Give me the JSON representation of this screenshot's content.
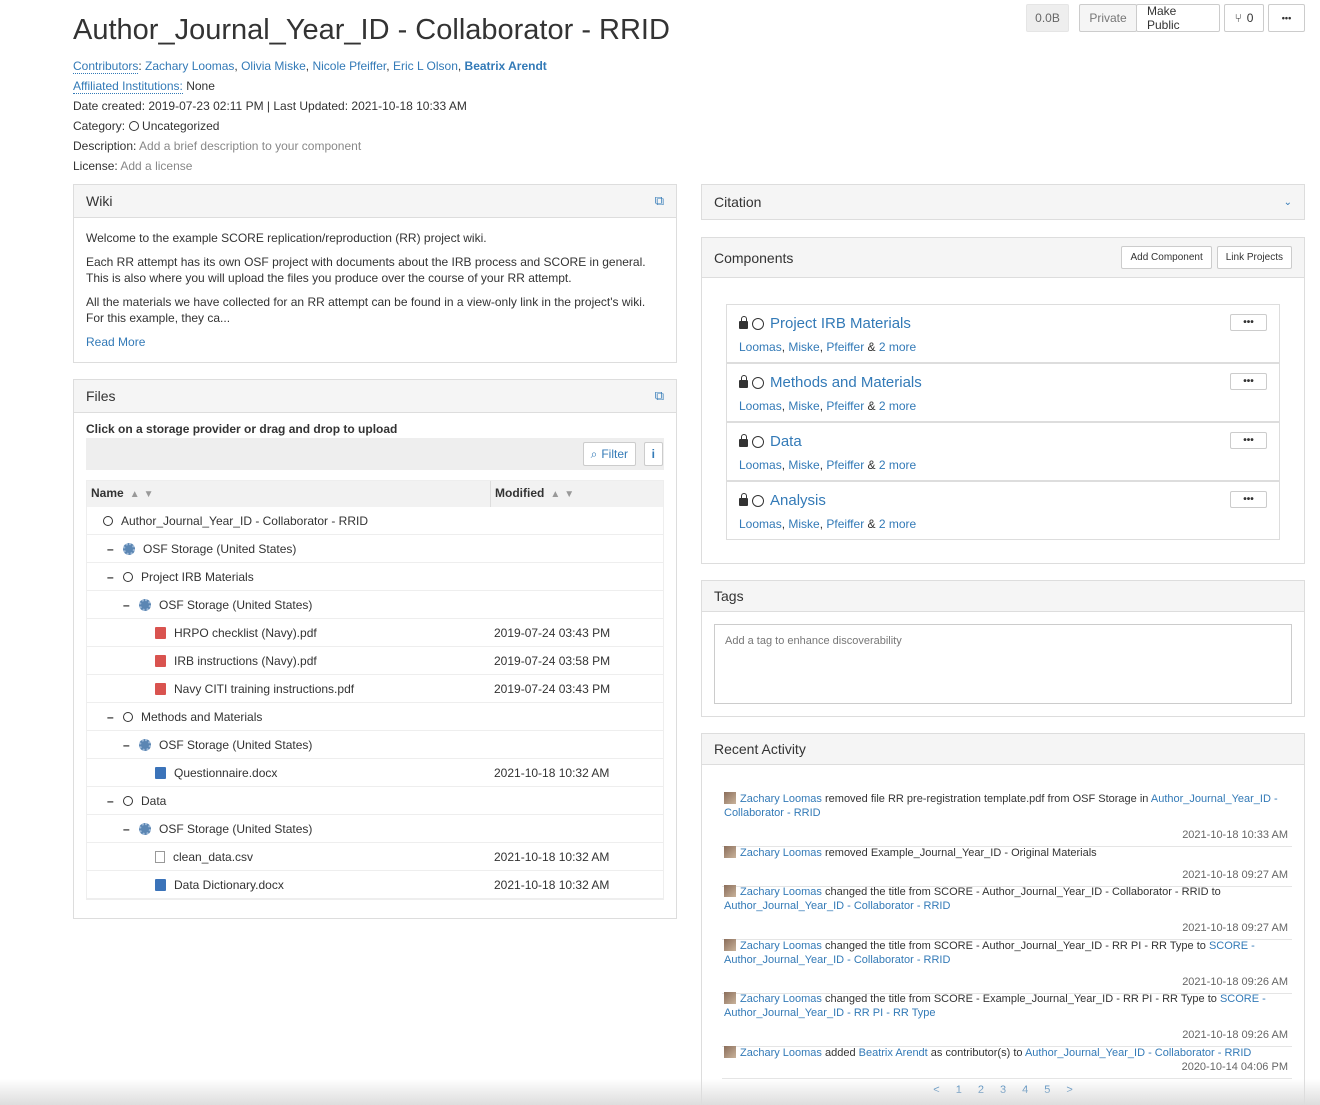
{
  "header": {
    "title": "Author_Journal_Year_ID - Collaborator - RRID",
    "size_badge": "0.0B",
    "private_label": "Private",
    "make_public_label": "Make Public",
    "fork_count": "0",
    "more_label": "•••"
  },
  "meta": {
    "contributors_label": "Contributors",
    "contributors": [
      "Zachary Loomas",
      "Olivia Miske",
      "Nicole Pfeiffer",
      "Eric L Olson",
      "Beatrix Arendt"
    ],
    "affiliated_label": "Affiliated Institutions:",
    "affiliated_value": "None",
    "dates": "Date created: 2019-07-23 02:11 PM | Last Updated: 2021-10-18 10:33 AM",
    "category_label": "Category:",
    "category_value": "Uncategorized",
    "description_label": "Description:",
    "description_value": "Add a brief description to your component",
    "license_label": "License:",
    "license_value": "Add a license"
  },
  "wiki": {
    "title": "Wiki",
    "p1": "Welcome to the example SCORE replication/reproduction (RR) project wiki.",
    "p2": "Each RR attempt has its own OSF project with documents about the IRB process and SCORE in general. This is also where you will upload the files you produce over the course of your RR attempt.",
    "p3": "All the materials we have collected for an RR attempt can be found in a view-only link in the project's wiki. For this example, they ca...",
    "read_more": "Read More"
  },
  "files": {
    "title": "Files",
    "hint": "Click on a storage provider or drag and drop to upload",
    "filter_label": "Filter",
    "info_label": "i",
    "col_name": "Name",
    "col_modified": "Modified",
    "rows": [
      {
        "name": "Author_Journal_Year_ID - Collaborator - RRID",
        "modified": ""
      },
      {
        "name": "OSF Storage (United States)",
        "modified": ""
      },
      {
        "name": "Project IRB Materials",
        "modified": ""
      },
      {
        "name": "OSF Storage (United States)",
        "modified": ""
      },
      {
        "name": "HRPO checklist (Navy).pdf",
        "modified": "2019-07-24 03:43 PM"
      },
      {
        "name": "IRB instructions (Navy).pdf",
        "modified": "2019-07-24 03:58 PM"
      },
      {
        "name": "Navy CITI training instructions.pdf",
        "modified": "2019-07-24 03:43 PM"
      },
      {
        "name": "Methods and Materials",
        "modified": ""
      },
      {
        "name": "OSF Storage (United States)",
        "modified": ""
      },
      {
        "name": "Questionnaire.docx",
        "modified": "2021-10-18 10:32 AM"
      },
      {
        "name": "Data",
        "modified": ""
      },
      {
        "name": "OSF Storage (United States)",
        "modified": ""
      },
      {
        "name": "clean_data.csv",
        "modified": "2021-10-18 10:32 AM"
      },
      {
        "name": "Data Dictionary.docx",
        "modified": "2021-10-18 10:32 AM"
      }
    ]
  },
  "citation": {
    "title": "Citation"
  },
  "components": {
    "title": "Components",
    "add_label": "Add Component",
    "link_label": "Link Projects",
    "items": [
      {
        "name": "Project IRB Materials",
        "c1": "Loomas",
        "c2": "Miske",
        "c3": "Pfeiffer",
        "more": "2 more"
      },
      {
        "name": "Methods and Materials",
        "c1": "Loomas",
        "c2": "Miske",
        "c3": "Pfeiffer",
        "more": "2 more"
      },
      {
        "name": "Data",
        "c1": "Loomas",
        "c2": "Miske",
        "c3": "Pfeiffer",
        "more": "2 more"
      },
      {
        "name": "Analysis",
        "c1": "Loomas",
        "c2": "Miske",
        "c3": "Pfeiffer",
        "more": "2 more"
      }
    ]
  },
  "tags": {
    "title": "Tags",
    "placeholder": "Add a tag to enhance discoverability"
  },
  "activity": {
    "title": "Recent Activity",
    "items": [
      {
        "user": "Zachary Loomas",
        "text": " removed file RR pre-registration template.pdf from OSF Storage in ",
        "target": "Author_Journal_Year_ID - Collaborator - RRID",
        "time": "2021-10-18 10:33 AM"
      },
      {
        "user": "Zachary Loomas",
        "text": " removed Example_Journal_Year_ID - Original Materials",
        "target": "",
        "time": "2021-10-18 09:27 AM"
      },
      {
        "user": "Zachary Loomas",
        "text": " changed the title from SCORE - Author_Journal_Year_ID - Collaborator - RRID to ",
        "target": "Author_Journal_Year_ID - Collaborator - RRID",
        "time": "2021-10-18 09:27 AM"
      },
      {
        "user": "Zachary Loomas",
        "text": " changed the title from SCORE - Author_Journal_Year_ID - RR PI - RR Type to ",
        "target": "SCORE - Author_Journal_Year_ID - Collaborator - RRID",
        "time": "2021-10-18 09:26 AM"
      },
      {
        "user": "Zachary Loomas",
        "text": " changed the title from SCORE - Example_Journal_Year_ID - RR PI - RR Type to ",
        "target": "SCORE - Author_Journal_Year_ID - RR PI - RR Type",
        "time": "2021-10-18 09:26 AM"
      },
      {
        "user": "Zachary Loomas",
        "text": " added ",
        "target2": "Beatrix Arendt",
        "text2": " as contributor(s) to ",
        "target": "Author_Journal_Year_ID - Collaborator - RRID",
        "time": "2020-10-14 04:06 PM"
      }
    ],
    "pager": [
      "<",
      "1",
      "2",
      "3",
      "4",
      "5",
      ">"
    ]
  }
}
